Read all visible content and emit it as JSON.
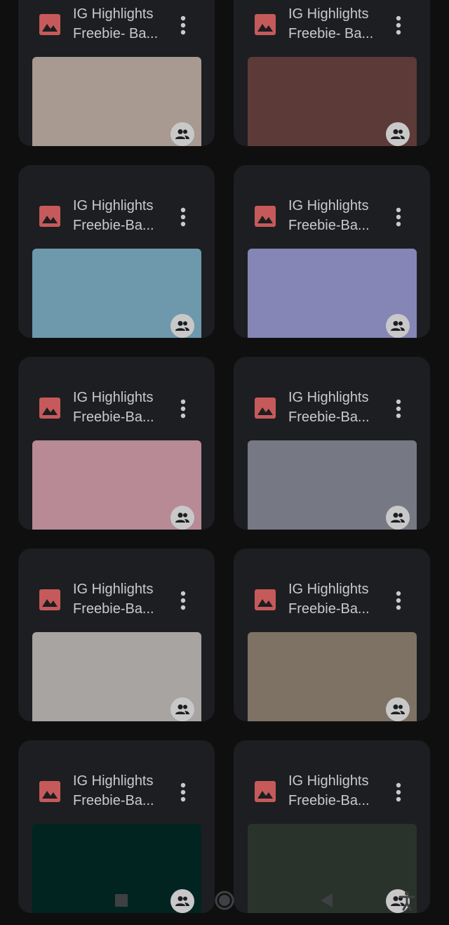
{
  "files": [
    {
      "title_line1": "IG Highlights",
      "title_line2": "Freebie- Ba...",
      "thumb_color": "#a89a90"
    },
    {
      "title_line1": "IG Highlights",
      "title_line2": "Freebie- Ba...",
      "thumb_color": "#5c3a38"
    },
    {
      "title_line1": "IG Highlights",
      "title_line2": "Freebie-Ba...",
      "thumb_color": "#6e99ad"
    },
    {
      "title_line1": "IG Highlights",
      "title_line2": "Freebie-Ba...",
      "thumb_color": "#8586b6"
    },
    {
      "title_line1": "IG Highlights",
      "title_line2": "Freebie-Ba...",
      "thumb_color": "#b78a96"
    },
    {
      "title_line1": "IG Highlights",
      "title_line2": "Freebie-Ba...",
      "thumb_color": "#767983"
    },
    {
      "title_line1": "IG Highlights",
      "title_line2": "Freebie-Ba...",
      "thumb_color": "#a8a4a2"
    },
    {
      "title_line1": "IG Highlights",
      "title_line2": "Freebie-Ba...",
      "thumb_color": "#7d7264"
    },
    {
      "title_line1": "IG Highlights",
      "title_line2": "Freebie-Ba...",
      "thumb_color": "#022421"
    },
    {
      "title_line1": "IG Highlights",
      "title_line2": "Freebie-Ba...",
      "thumb_color": "#2a332b"
    }
  ],
  "colors": {
    "image_icon": "#c65a5b",
    "card_bg": "#1d1e21",
    "page_bg": "#0f0f10",
    "title_text": "#c9cacd"
  },
  "icons": {
    "file_type": "image-icon",
    "more": "more-vert-icon",
    "shared": "people-icon",
    "nav_recent": "square-icon",
    "nav_home": "circle-icon",
    "nav_back": "triangle-icon",
    "accessibility": "accessibility-icon"
  }
}
